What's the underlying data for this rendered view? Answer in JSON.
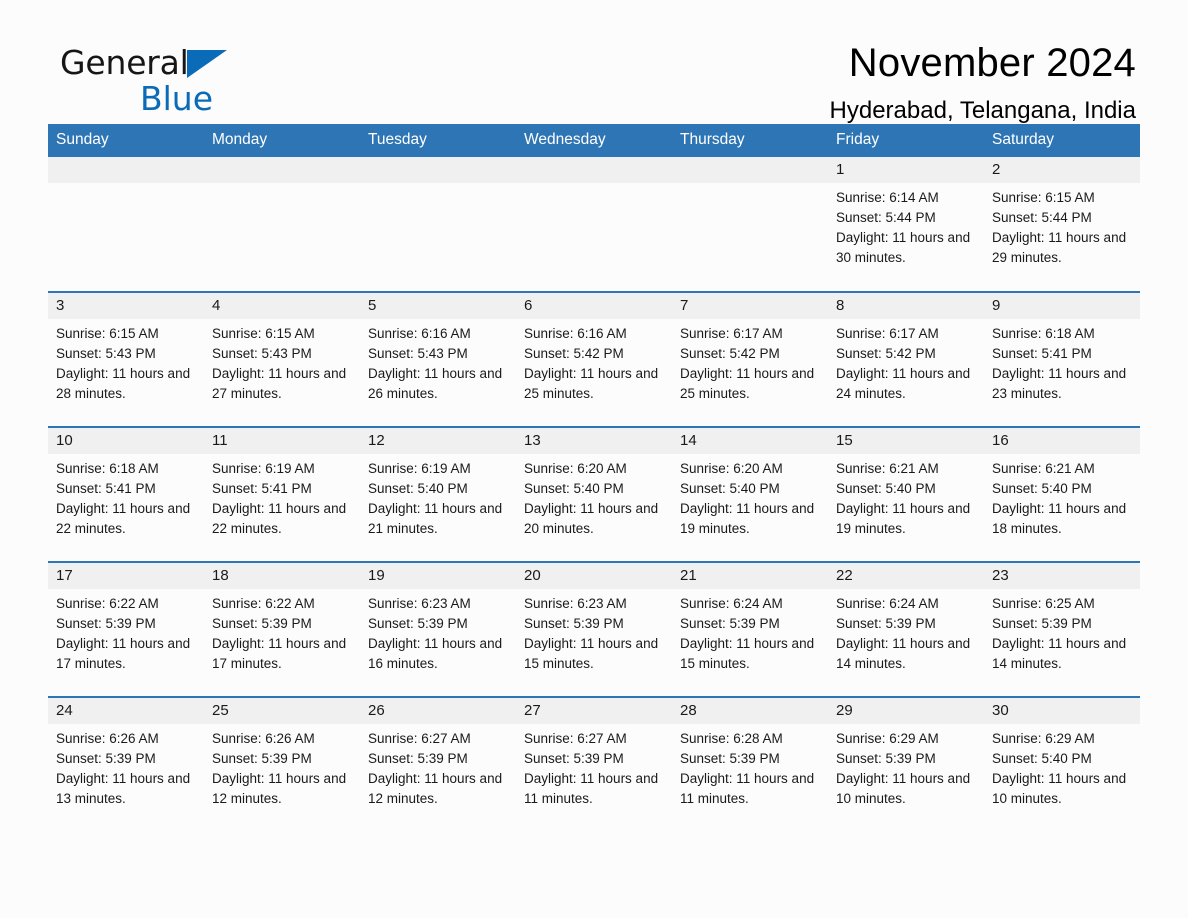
{
  "brand": {
    "name_part1": "General",
    "name_part2": "Blue",
    "triangle_color": "#0a6cb8"
  },
  "header": {
    "title": "November 2024",
    "subtitle": "Hyderabad, Telangana, India"
  },
  "theme": {
    "header_bg": "#2e75b6",
    "header_text": "#ffffff",
    "daynum_bg": "#f0f0f0",
    "row_divider": "#2e75b6",
    "page_bg": "#fcfcfc"
  },
  "weekday_headers": [
    "Sunday",
    "Monday",
    "Tuesday",
    "Wednesday",
    "Thursday",
    "Friday",
    "Saturday"
  ],
  "labels": {
    "sunrise_prefix": "Sunrise:",
    "sunset_prefix": "Sunset:",
    "daylight_prefix": "Daylight:"
  },
  "weeks": [
    [
      {
        "day": "",
        "empty": true
      },
      {
        "day": "",
        "empty": true
      },
      {
        "day": "",
        "empty": true
      },
      {
        "day": "",
        "empty": true
      },
      {
        "day": "",
        "empty": true
      },
      {
        "day": "1",
        "sunrise": "Sunrise: 6:14 AM",
        "sunset": "Sunset: 5:44 PM",
        "daylight": "Daylight: 11 hours and 30 minutes."
      },
      {
        "day": "2",
        "sunrise": "Sunrise: 6:15 AM",
        "sunset": "Sunset: 5:44 PM",
        "daylight": "Daylight: 11 hours and 29 minutes."
      }
    ],
    [
      {
        "day": "3",
        "sunrise": "Sunrise: 6:15 AM",
        "sunset": "Sunset: 5:43 PM",
        "daylight": "Daylight: 11 hours and 28 minutes."
      },
      {
        "day": "4",
        "sunrise": "Sunrise: 6:15 AM",
        "sunset": "Sunset: 5:43 PM",
        "daylight": "Daylight: 11 hours and 27 minutes."
      },
      {
        "day": "5",
        "sunrise": "Sunrise: 6:16 AM",
        "sunset": "Sunset: 5:43 PM",
        "daylight": "Daylight: 11 hours and 26 minutes."
      },
      {
        "day": "6",
        "sunrise": "Sunrise: 6:16 AM",
        "sunset": "Sunset: 5:42 PM",
        "daylight": "Daylight: 11 hours and 25 minutes."
      },
      {
        "day": "7",
        "sunrise": "Sunrise: 6:17 AM",
        "sunset": "Sunset: 5:42 PM",
        "daylight": "Daylight: 11 hours and 25 minutes."
      },
      {
        "day": "8",
        "sunrise": "Sunrise: 6:17 AM",
        "sunset": "Sunset: 5:42 PM",
        "daylight": "Daylight: 11 hours and 24 minutes."
      },
      {
        "day": "9",
        "sunrise": "Sunrise: 6:18 AM",
        "sunset": "Sunset: 5:41 PM",
        "daylight": "Daylight: 11 hours and 23 minutes."
      }
    ],
    [
      {
        "day": "10",
        "sunrise": "Sunrise: 6:18 AM",
        "sunset": "Sunset: 5:41 PM",
        "daylight": "Daylight: 11 hours and 22 minutes."
      },
      {
        "day": "11",
        "sunrise": "Sunrise: 6:19 AM",
        "sunset": "Sunset: 5:41 PM",
        "daylight": "Daylight: 11 hours and 22 minutes."
      },
      {
        "day": "12",
        "sunrise": "Sunrise: 6:19 AM",
        "sunset": "Sunset: 5:40 PM",
        "daylight": "Daylight: 11 hours and 21 minutes."
      },
      {
        "day": "13",
        "sunrise": "Sunrise: 6:20 AM",
        "sunset": "Sunset: 5:40 PM",
        "daylight": "Daylight: 11 hours and 20 minutes."
      },
      {
        "day": "14",
        "sunrise": "Sunrise: 6:20 AM",
        "sunset": "Sunset: 5:40 PM",
        "daylight": "Daylight: 11 hours and 19 minutes."
      },
      {
        "day": "15",
        "sunrise": "Sunrise: 6:21 AM",
        "sunset": "Sunset: 5:40 PM",
        "daylight": "Daylight: 11 hours and 19 minutes."
      },
      {
        "day": "16",
        "sunrise": "Sunrise: 6:21 AM",
        "sunset": "Sunset: 5:40 PM",
        "daylight": "Daylight: 11 hours and 18 minutes."
      }
    ],
    [
      {
        "day": "17",
        "sunrise": "Sunrise: 6:22 AM",
        "sunset": "Sunset: 5:39 PM",
        "daylight": "Daylight: 11 hours and 17 minutes."
      },
      {
        "day": "18",
        "sunrise": "Sunrise: 6:22 AM",
        "sunset": "Sunset: 5:39 PM",
        "daylight": "Daylight: 11 hours and 17 minutes."
      },
      {
        "day": "19",
        "sunrise": "Sunrise: 6:23 AM",
        "sunset": "Sunset: 5:39 PM",
        "daylight": "Daylight: 11 hours and 16 minutes."
      },
      {
        "day": "20",
        "sunrise": "Sunrise: 6:23 AM",
        "sunset": "Sunset: 5:39 PM",
        "daylight": "Daylight: 11 hours and 15 minutes."
      },
      {
        "day": "21",
        "sunrise": "Sunrise: 6:24 AM",
        "sunset": "Sunset: 5:39 PM",
        "daylight": "Daylight: 11 hours and 15 minutes."
      },
      {
        "day": "22",
        "sunrise": "Sunrise: 6:24 AM",
        "sunset": "Sunset: 5:39 PM",
        "daylight": "Daylight: 11 hours and 14 minutes."
      },
      {
        "day": "23",
        "sunrise": "Sunrise: 6:25 AM",
        "sunset": "Sunset: 5:39 PM",
        "daylight": "Daylight: 11 hours and 14 minutes."
      }
    ],
    [
      {
        "day": "24",
        "sunrise": "Sunrise: 6:26 AM",
        "sunset": "Sunset: 5:39 PM",
        "daylight": "Daylight: 11 hours and 13 minutes."
      },
      {
        "day": "25",
        "sunrise": "Sunrise: 6:26 AM",
        "sunset": "Sunset: 5:39 PM",
        "daylight": "Daylight: 11 hours and 12 minutes."
      },
      {
        "day": "26",
        "sunrise": "Sunrise: 6:27 AM",
        "sunset": "Sunset: 5:39 PM",
        "daylight": "Daylight: 11 hours and 12 minutes."
      },
      {
        "day": "27",
        "sunrise": "Sunrise: 6:27 AM",
        "sunset": "Sunset: 5:39 PM",
        "daylight": "Daylight: 11 hours and 11 minutes."
      },
      {
        "day": "28",
        "sunrise": "Sunrise: 6:28 AM",
        "sunset": "Sunset: 5:39 PM",
        "daylight": "Daylight: 11 hours and 11 minutes."
      },
      {
        "day": "29",
        "sunrise": "Sunrise: 6:29 AM",
        "sunset": "Sunset: 5:39 PM",
        "daylight": "Daylight: 11 hours and 10 minutes."
      },
      {
        "day": "30",
        "sunrise": "Sunrise: 6:29 AM",
        "sunset": "Sunset: 5:40 PM",
        "daylight": "Daylight: 11 hours and 10 minutes."
      }
    ]
  ]
}
